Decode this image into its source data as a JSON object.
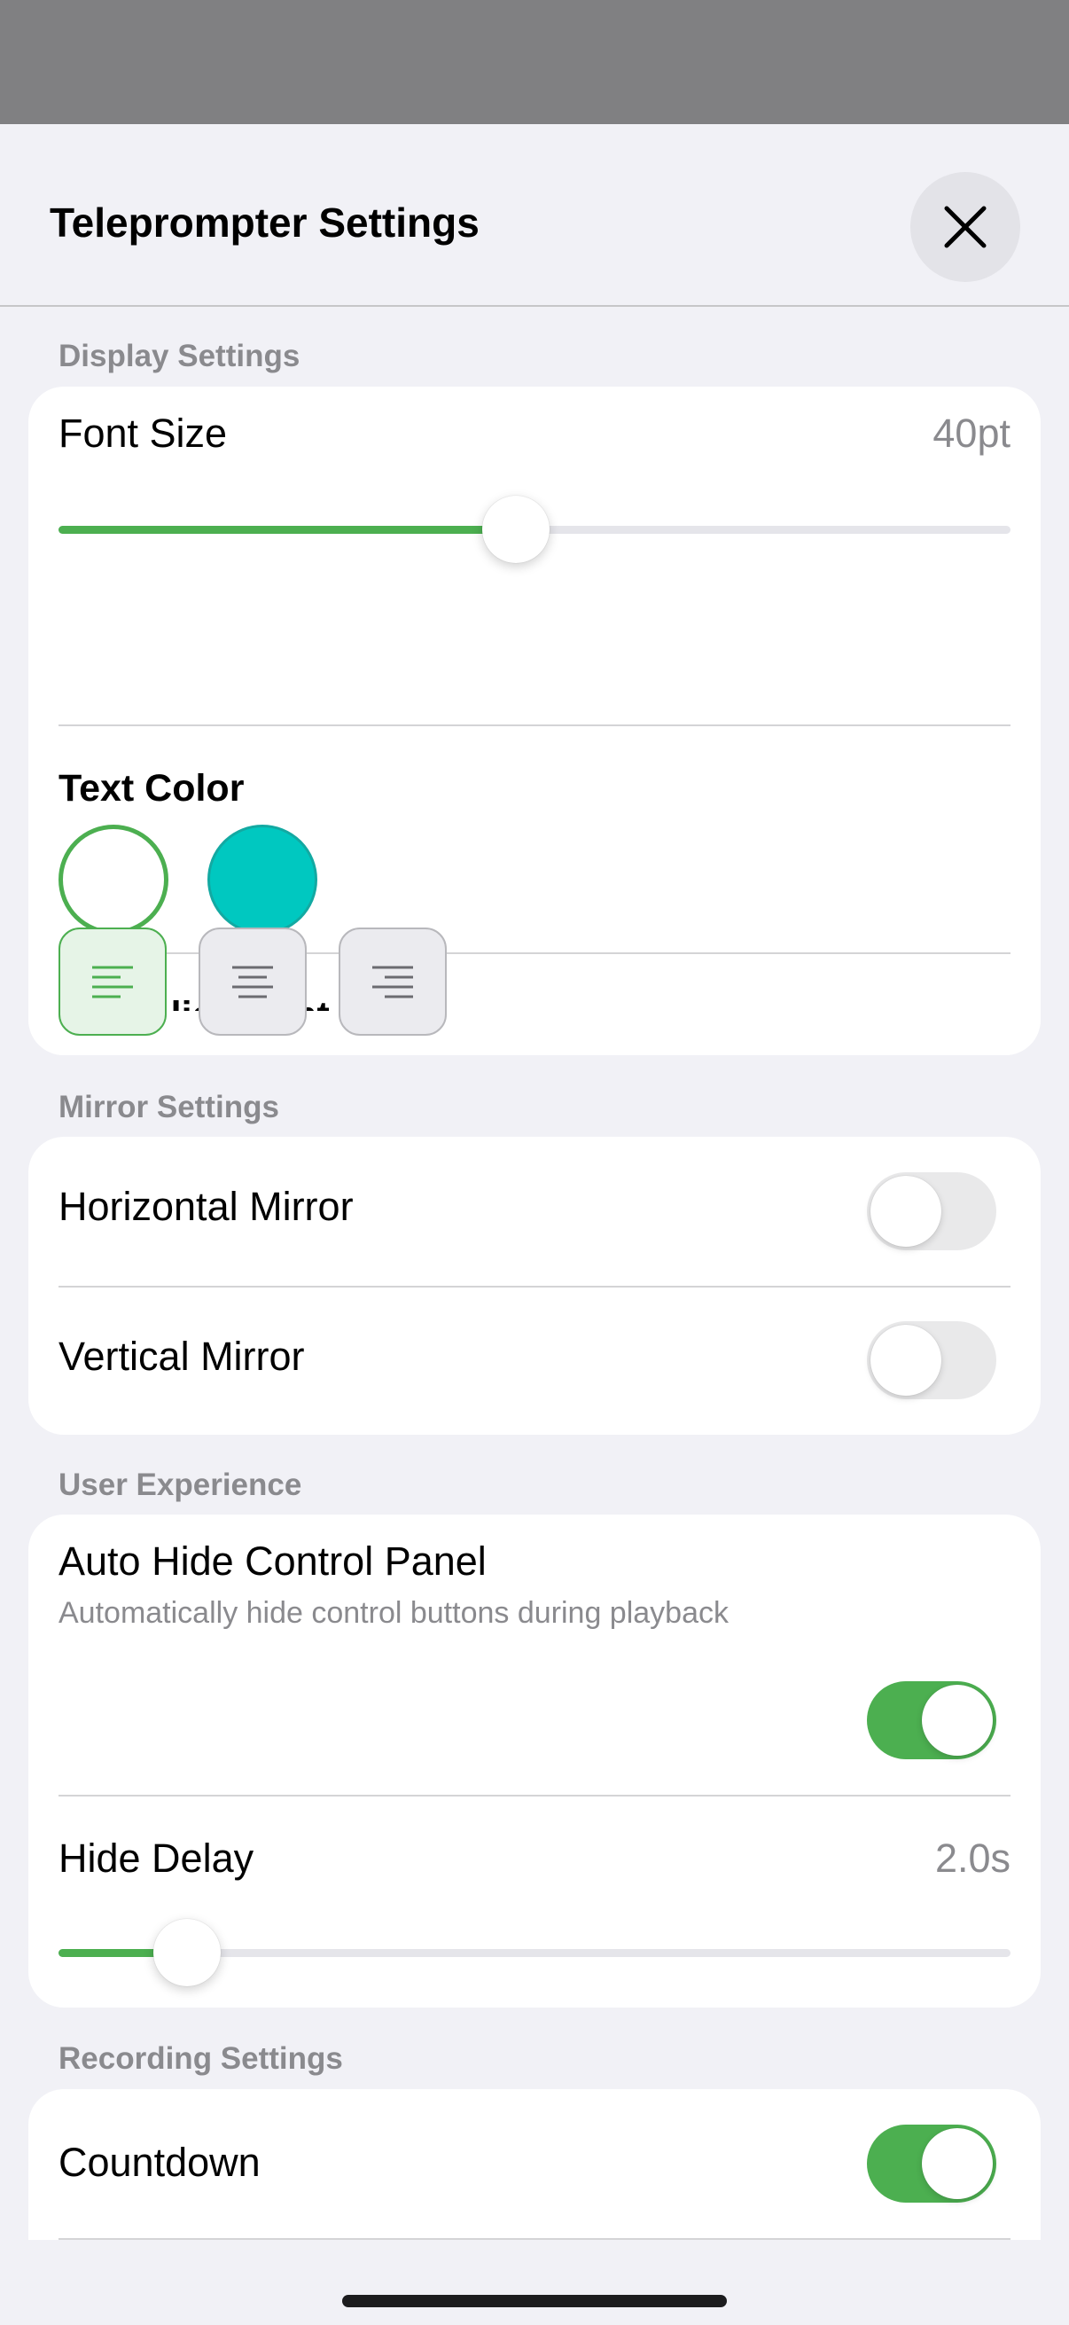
{
  "header": {
    "title": "Teleprompter Settings"
  },
  "sections": {
    "display": {
      "label": "Display Settings",
      "font_size": {
        "label": "Font Size",
        "value": "40pt",
        "slider_fraction": 0.48
      },
      "text_color": {
        "label": "Text Color",
        "options": [
          "#ffffff",
          "#00c8c0"
        ],
        "selected_index": 0
      },
      "text_alignment": {
        "label": "Text Alignment",
        "options": [
          "align-left-icon",
          "align-center-icon",
          "align-right-icon"
        ],
        "selected_index": 0
      }
    },
    "mirror": {
      "label": "Mirror Settings",
      "horizontal": {
        "label": "Horizontal Mirror",
        "on": false
      },
      "vertical": {
        "label": "Vertical Mirror",
        "on": false
      }
    },
    "user_experience": {
      "label": "User Experience",
      "auto_hide": {
        "label": "Auto Hide Control Panel",
        "description": "Automatically hide control buttons during playback",
        "on": true
      },
      "hide_delay": {
        "label": "Hide Delay",
        "value": "2.0s",
        "slider_fraction": 0.135
      }
    },
    "recording": {
      "label": "Recording Settings",
      "countdown": {
        "label": "Countdown",
        "on": true
      }
    }
  },
  "colors": {
    "accent": "#4caf50",
    "teal": "#00c8c0"
  }
}
